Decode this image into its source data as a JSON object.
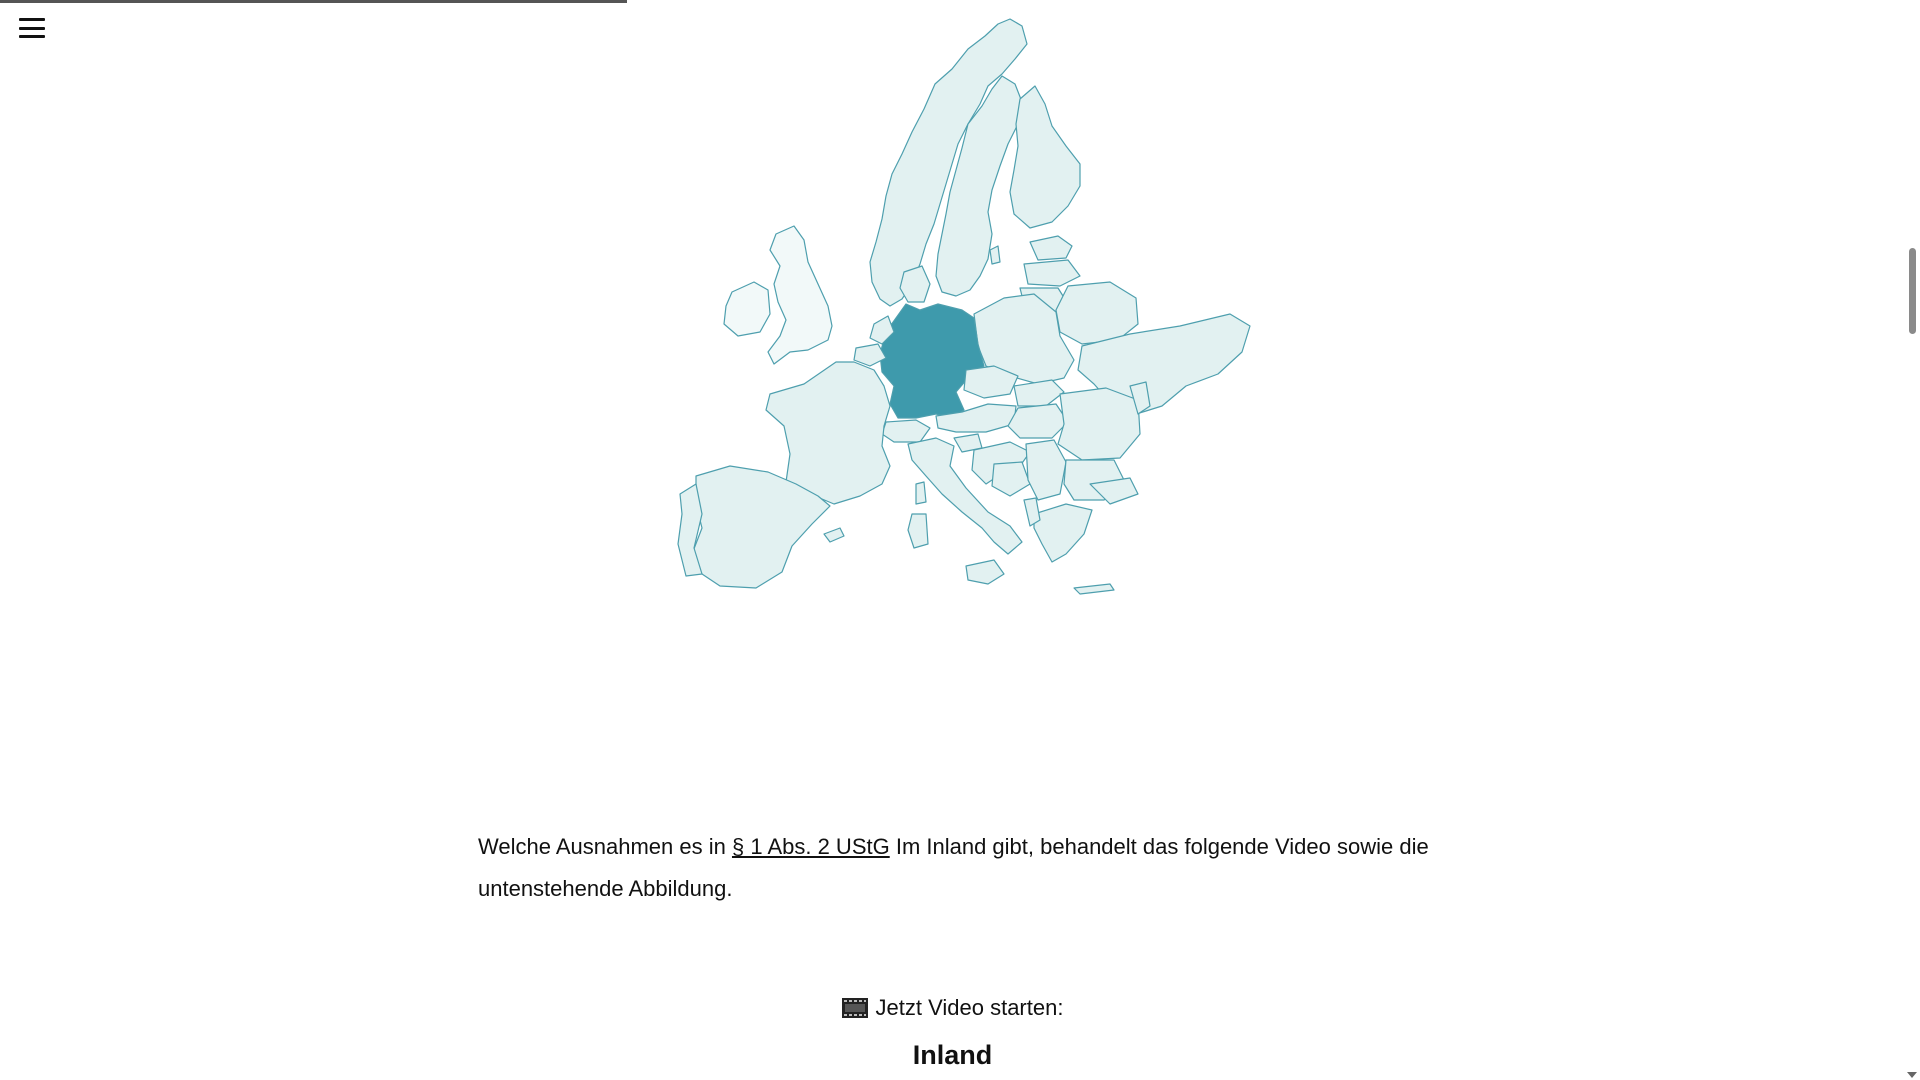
{
  "reading_progress": 0.33,
  "colors": {
    "highlight_country": "#3e9aac",
    "other_countries": "#e2f1f1",
    "excluded_countries": "#f2f9f9",
    "border": "#4e9fae"
  },
  "map": {
    "highlighted_country": "germany"
  },
  "content": {
    "paragraph_before_link": "Welche Ausnahmen es in ",
    "link_text": "§ 1 Abs. 2 UStG",
    "paragraph_after_link": " Im Inland gibt, behandelt das folgende Video sowie die untenstehende Abbildung.",
    "video_cta": "Jetzt Video starten:",
    "video_icon": "film-frames-icon",
    "section_heading": "Inland"
  }
}
